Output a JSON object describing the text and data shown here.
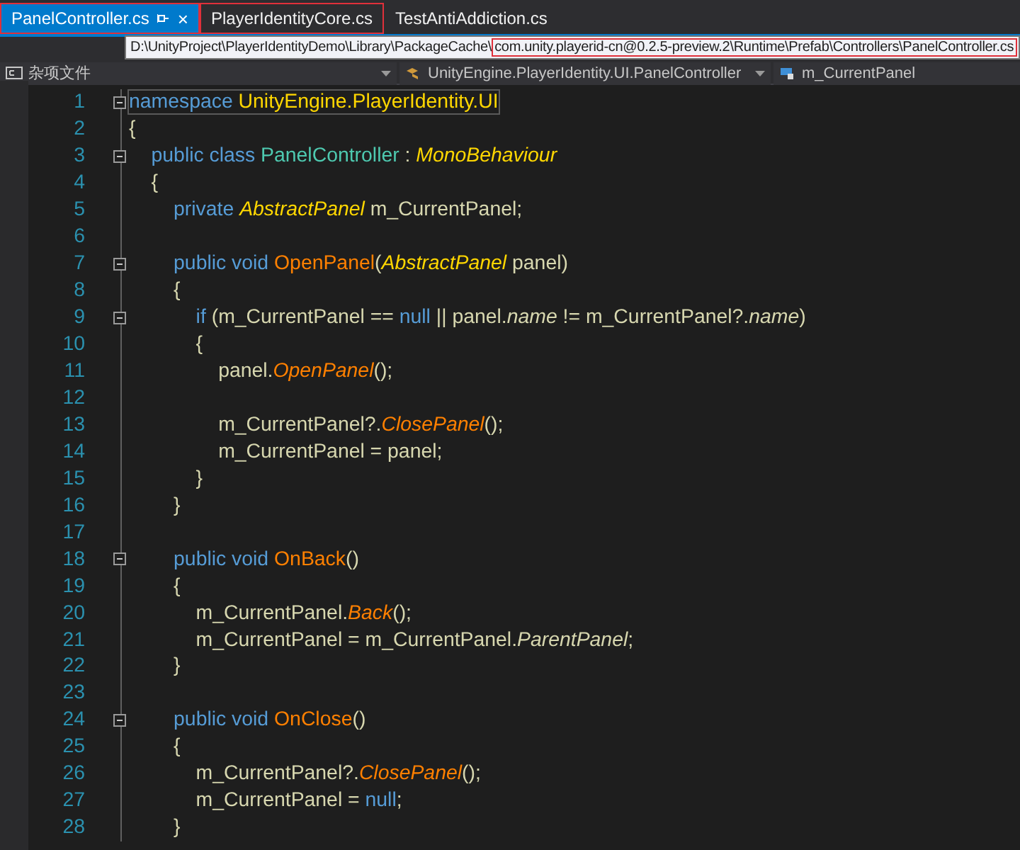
{
  "tabs": [
    {
      "label": "PanelController.cs",
      "selected": true,
      "highlighted": true,
      "close": "×"
    },
    {
      "label": "PlayerIdentityCore.cs",
      "selected": false,
      "highlighted": true
    },
    {
      "label": "TestAntiAddiction.cs",
      "selected": false,
      "highlighted": false
    }
  ],
  "tooltip": {
    "parts": [
      {
        "text": "D:\\UnityProject\\PlayerIdentityDemo\\Library\\PackageCache\\",
        "highlighted": false
      },
      {
        "text": "com.unity.playerid-cn@0.2.5-preview.2\\Runtime\\Prefab\\Controllers\\PanelController.cs",
        "highlighted": true
      }
    ]
  },
  "navigation_bar": {
    "project": "杂项文件",
    "type": "UnityEngine.PlayerIdentity.UI.PanelController",
    "member": "m_CurrentPanel"
  },
  "editor": {
    "lines": [
      {
        "number": "1",
        "fold": true,
        "tokens": [
          {
            "kind": "keyword",
            "text": "namespace "
          },
          {
            "kind": "namespace",
            "text": "UnityEngine.PlayerIdentity.UI"
          }
        ]
      },
      {
        "number": "2",
        "fold": false,
        "tokens": [
          {
            "kind": "plain",
            "text": "{"
          }
        ]
      },
      {
        "number": "3",
        "fold": true,
        "tokens": [
          {
            "kind": "keyword",
            "text": "    public class "
          },
          {
            "kind": "type",
            "text": "PanelController"
          },
          {
            "kind": "plain",
            "text": " : "
          },
          {
            "kind": "interface",
            "text": "MonoBehaviour"
          }
        ]
      },
      {
        "number": "4",
        "fold": false,
        "tokens": [
          {
            "kind": "plain",
            "text": "    {"
          }
        ]
      },
      {
        "number": "5",
        "fold": false,
        "tokens": [
          {
            "kind": "keyword",
            "text": "        private "
          },
          {
            "kind": "interface",
            "text": "AbstractPanel"
          },
          {
            "kind": "plain",
            "text": " m_CurrentPanel;"
          }
        ]
      },
      {
        "number": "6",
        "fold": false
      },
      {
        "number": "7",
        "fold": true,
        "tokens": [
          {
            "kind": "keyword",
            "text": "        public void "
          },
          {
            "kind": "method",
            "text": "OpenPanel"
          },
          {
            "kind": "plain",
            "text": "("
          },
          {
            "kind": "interface",
            "text": "AbstractPanel"
          },
          {
            "kind": "plain",
            "text": " panel)"
          }
        ]
      },
      {
        "number": "8",
        "fold": false,
        "tokens": [
          {
            "kind": "plain",
            "text": "        {"
          }
        ]
      },
      {
        "number": "9",
        "fold": true,
        "tokens": [
          {
            "kind": "keyword",
            "text": "            if"
          },
          {
            "kind": "plain",
            "text": " (m_CurrentPanel == "
          },
          {
            "kind": "keyword",
            "text": "null"
          },
          {
            "kind": "plain",
            "text": " || panel."
          },
          {
            "kind": "property",
            "text": "name"
          },
          {
            "kind": "plain",
            "text": " != m_CurrentPanel?."
          },
          {
            "kind": "property",
            "text": "name"
          },
          {
            "kind": "plain",
            "text": ")"
          }
        ]
      },
      {
        "number": "10",
        "fold": false,
        "tokens": [
          {
            "kind": "plain",
            "text": "            {"
          }
        ]
      },
      {
        "number": "11",
        "fold": false,
        "tokens": [
          {
            "kind": "plain",
            "text": "                panel."
          },
          {
            "kind": "call",
            "text": "OpenPanel"
          },
          {
            "kind": "plain",
            "text": "();"
          }
        ]
      },
      {
        "number": "12",
        "fold": false
      },
      {
        "number": "13",
        "fold": false,
        "tokens": [
          {
            "kind": "plain",
            "text": "                m_CurrentPanel?."
          },
          {
            "kind": "call",
            "text": "ClosePanel"
          },
          {
            "kind": "plain",
            "text": "();"
          }
        ]
      },
      {
        "number": "14",
        "fold": false,
        "tokens": [
          {
            "kind": "plain",
            "text": "                m_CurrentPanel = panel;"
          }
        ]
      },
      {
        "number": "15",
        "fold": false,
        "tokens": [
          {
            "kind": "plain",
            "text": "            }"
          }
        ]
      },
      {
        "number": "16",
        "fold": false,
        "tokens": [
          {
            "kind": "plain",
            "text": "        }"
          }
        ]
      },
      {
        "number": "17",
        "fold": false
      },
      {
        "number": "18",
        "fold": true,
        "tokens": [
          {
            "kind": "keyword",
            "text": "        public void "
          },
          {
            "kind": "method",
            "text": "OnBack"
          },
          {
            "kind": "plain",
            "text": "()"
          }
        ]
      },
      {
        "number": "19",
        "fold": false,
        "tokens": [
          {
            "kind": "plain",
            "text": "        {"
          }
        ]
      },
      {
        "number": "20",
        "fold": false,
        "tokens": [
          {
            "kind": "plain",
            "text": "            m_CurrentPanel."
          },
          {
            "kind": "call",
            "text": "Back"
          },
          {
            "kind": "plain",
            "text": "();"
          }
        ]
      },
      {
        "number": "21",
        "fold": false,
        "tokens": [
          {
            "kind": "plain",
            "text": "            m_CurrentPanel = m_CurrentPanel."
          },
          {
            "kind": "property",
            "text": "ParentPanel"
          },
          {
            "kind": "plain",
            "text": ";"
          }
        ]
      },
      {
        "number": "22",
        "fold": false,
        "tokens": [
          {
            "kind": "plain",
            "text": "        }"
          }
        ]
      },
      {
        "number": "23",
        "fold": false
      },
      {
        "number": "24",
        "fold": true,
        "tokens": [
          {
            "kind": "keyword",
            "text": "        public void "
          },
          {
            "kind": "method",
            "text": "OnClose"
          },
          {
            "kind": "plain",
            "text": "()"
          }
        ]
      },
      {
        "number": "25",
        "fold": false,
        "tokens": [
          {
            "kind": "plain",
            "text": "        {"
          }
        ]
      },
      {
        "number": "26",
        "fold": false,
        "tokens": [
          {
            "kind": "plain",
            "text": "            m_CurrentPanel?."
          },
          {
            "kind": "call",
            "text": "ClosePanel"
          },
          {
            "kind": "plain",
            "text": "();"
          }
        ]
      },
      {
        "number": "27",
        "fold": false,
        "tokens": [
          {
            "kind": "plain",
            "text": "            m_CurrentPanel = "
          },
          {
            "kind": "keyword",
            "text": "null"
          },
          {
            "kind": "plain",
            "text": ";"
          }
        ]
      },
      {
        "number": "28",
        "fold": false,
        "tokens": [
          {
            "kind": "plain",
            "text": "        }"
          }
        ]
      }
    ]
  }
}
